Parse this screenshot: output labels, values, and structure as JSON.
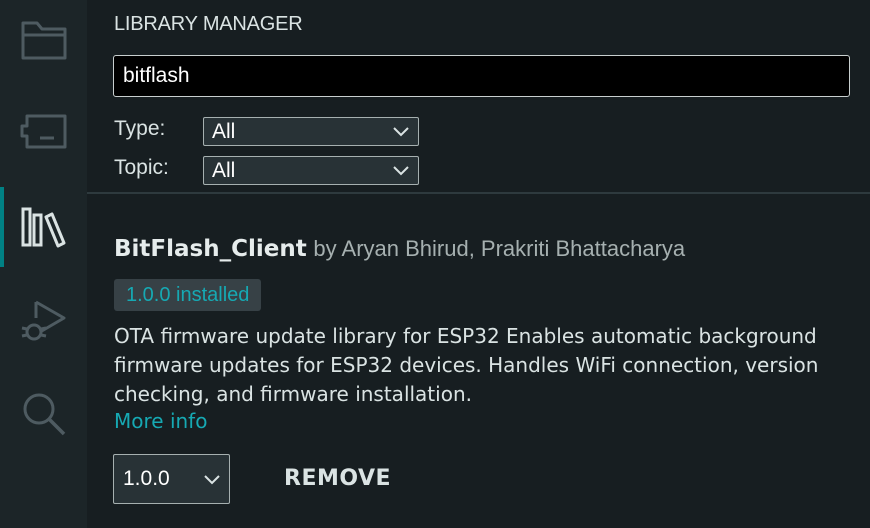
{
  "activity_bar": {
    "items": [
      {
        "icon": "folder-icon",
        "active": false
      },
      {
        "icon": "board-icon",
        "active": false
      },
      {
        "icon": "library-icon",
        "active": true
      },
      {
        "icon": "debug-icon",
        "active": false
      },
      {
        "icon": "search-icon",
        "active": false
      }
    ],
    "accent_color": "#008184"
  },
  "panel": {
    "title": "LIBRARY MANAGER",
    "search": {
      "value": "bitflash",
      "placeholder": ""
    },
    "filters": {
      "type_label": "Type:",
      "type_value": "All",
      "topic_label": "Topic:",
      "topic_value": "All"
    }
  },
  "library": {
    "name": "BitFlash_Client",
    "author": "by Aryan Bhirud, Prakriti Bhattacharya",
    "installed_badge": "1.0.0 installed",
    "description": "OTA firmware update library for ESP32 Enables automatic background firmware updates for ESP32 devices. Handles WiFi connection, version checking, and firmware installation.",
    "more_info": "More info",
    "version_selected": "1.0.0",
    "remove_label": "REMOVE"
  },
  "colors": {
    "background": "#171e21",
    "activity_bar": "#1c2528",
    "teal": "#16a9b3",
    "text": "#dae3e3"
  }
}
